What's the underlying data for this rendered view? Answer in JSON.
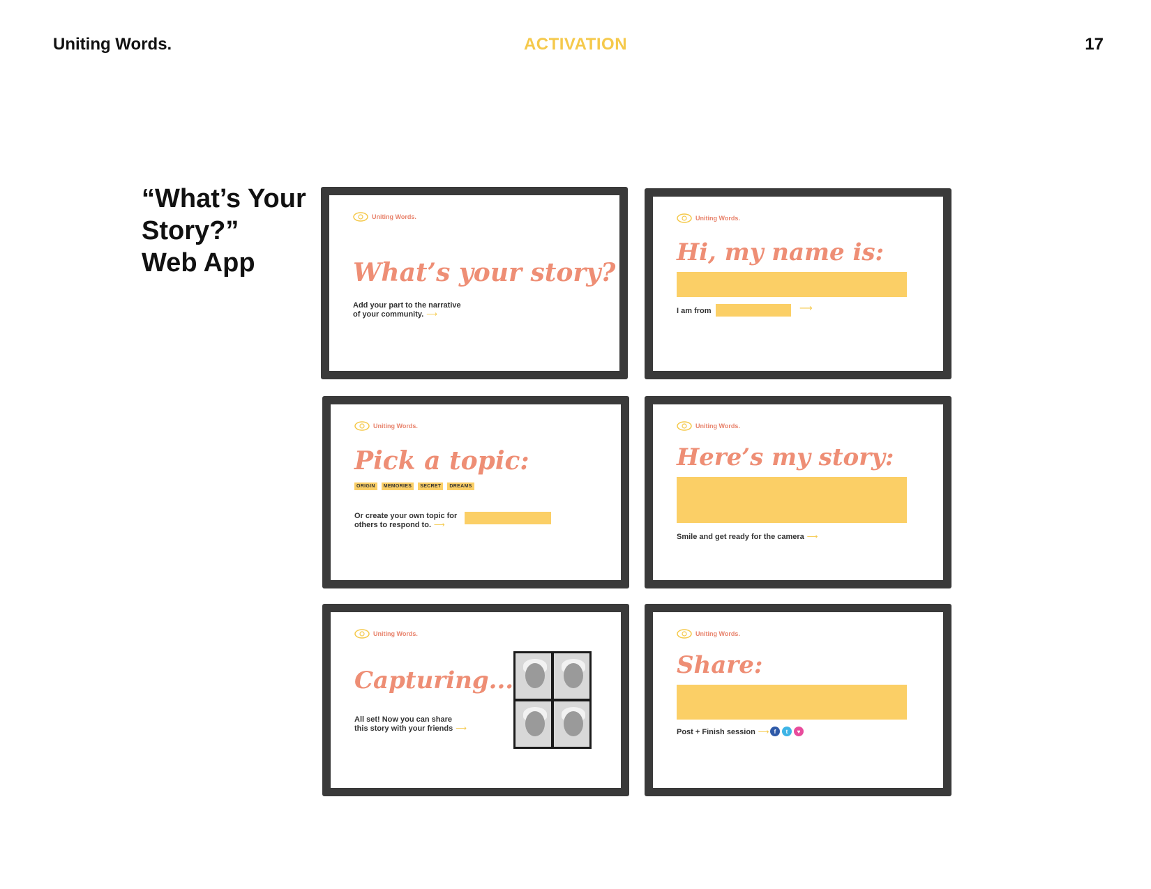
{
  "header": {
    "brand": "Uniting Words.",
    "section": "ACTIVATION",
    "page_number": "17"
  },
  "side_title": {
    "line1": "“What’s Your",
    "line2": "Story?”",
    "line3": "Web App"
  },
  "colors": {
    "accent_yellow": "#fbcf66",
    "headline_coral": "#ee8e75",
    "section_yellow": "#f5c94b",
    "frame": "#3a3a3a"
  },
  "app_logo_text": "Uniting Words.",
  "screens": {
    "intro": {
      "headline": "What’s your story?",
      "text_line1": "Add your part to the narrative",
      "text_line2": "of your community.",
      "arrow": "⟶"
    },
    "name": {
      "headline": "Hi, my name is:",
      "from_label": "I am from",
      "arrow": "⟶"
    },
    "topic": {
      "headline": "Pick a topic:",
      "chips": [
        "ORIGIN",
        "MEMORIES",
        "SECRET",
        "DREAMS"
      ],
      "text_line1": "Or create your own topic for",
      "text_line2": "others to respond to.",
      "arrow": "⟶"
    },
    "story": {
      "headline": "Here’s my story:",
      "text": "Smile and get ready for the camera",
      "arrow": "⟶"
    },
    "capture": {
      "headline": "Capturing...",
      "text_line1": "All set! Now you can share",
      "text_line2": "this story with your friends",
      "arrow": "⟶"
    },
    "share": {
      "headline": "Share:",
      "text": "Post + Finish session",
      "arrow": "⟶",
      "social_icons": [
        "facebook-icon",
        "twitter-icon",
        "heart-icon"
      ]
    }
  }
}
